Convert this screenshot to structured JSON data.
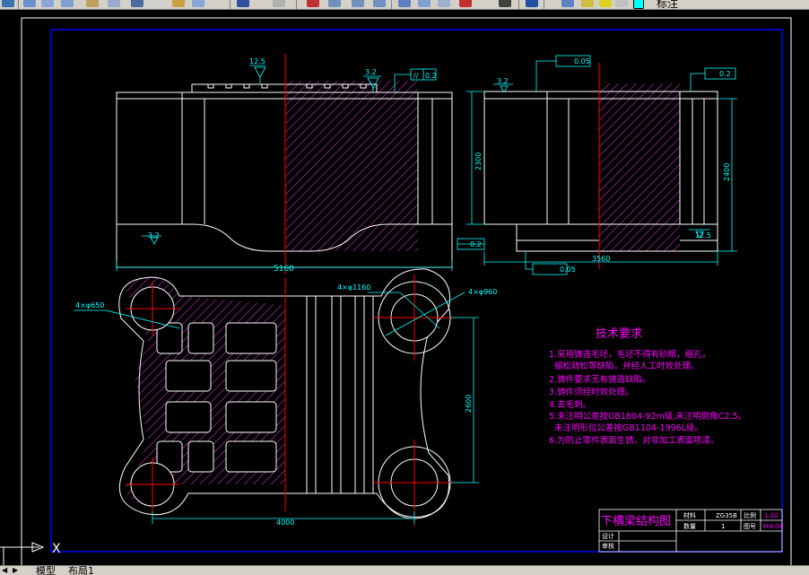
{
  "toolbar": {
    "layer_name": "标注",
    "icons": [
      "save-icon",
      "print-icon",
      "preview-icon",
      "publish-icon",
      "cut-icon",
      "copy-icon",
      "paste-icon",
      "match-icon",
      "undo-icon",
      "redo-icon",
      "pan-icon",
      "zoom-realtime-icon",
      "zoom-window-icon",
      "zoom-previous-icon",
      "properties-icon",
      "design-center-icon",
      "tool-palette-icon",
      "sheet-set-icon",
      "markup-icon",
      "calc-icon",
      "help-icon",
      "layer-manager-icon",
      "layer-state-icon"
    ]
  },
  "tabs": {
    "model": "模型",
    "layout1": "布局1"
  },
  "colors": {
    "background": "#000000",
    "frame": "#0000ff",
    "geometry": "#ffffff",
    "dimension": "#00ffff",
    "centerline": "#ff0000",
    "hatch": "#cc33cc",
    "text": "#ff00ff",
    "title": "#ff00ff"
  },
  "front_view": {
    "width_dim": "5160",
    "roughness_top_left": "12.5",
    "roughness_top_right": "3.2",
    "roughness_bottom": "3.2",
    "parallelism_symbol": "//",
    "parallelism_value": "0.2"
  },
  "side_view": {
    "flatness_value_top": "0.05",
    "parallelism_value_top": "0.2",
    "roughness_left": "3.2",
    "height_dim_left": "2300",
    "height_dim_right": "2400",
    "parallelism_value_bottom": "0.2",
    "roughness_bottom_right": "12.5",
    "width_dim": "3560",
    "flatness_value_bottom": "0.05"
  },
  "plan_view": {
    "hole_label_left": "4×φ650",
    "hole_label_mid": "4×φ1160",
    "hole_label_right": "4×φ960",
    "height_dim": "2600",
    "width_dim": "4000"
  },
  "requirements": {
    "title": "技术要求",
    "lines": [
      "1.采用铸造毛坯，毛坯不得有砂眼，缩孔，",
      "  缩松疏松等缺陷，并经人工时效处理。",
      "2.铸件要求无有铸造缺陷。",
      "3.铸件须经时效处理。",
      "4.去毛刺。",
      "5.未注明公差按GB1804-92m级,未注明倒角C2.5。",
      "  未注明形位公差按GB1104-1996L级。",
      "6.为防止零件表面生锈，对非加工表面喷漆。"
    ]
  },
  "title_block": {
    "title": "下横梁结构图",
    "material_label": "材料",
    "material_value": "ZG35B",
    "scale_label": "比例",
    "scale_value": "1:20",
    "qty_label": "数量",
    "qty_value": "1",
    "drawing_no_label": "图号",
    "drawing_no_value": "XHL04",
    "design_label": "设计",
    "review_label": "审核"
  },
  "ucs": {
    "x_label": "X"
  }
}
